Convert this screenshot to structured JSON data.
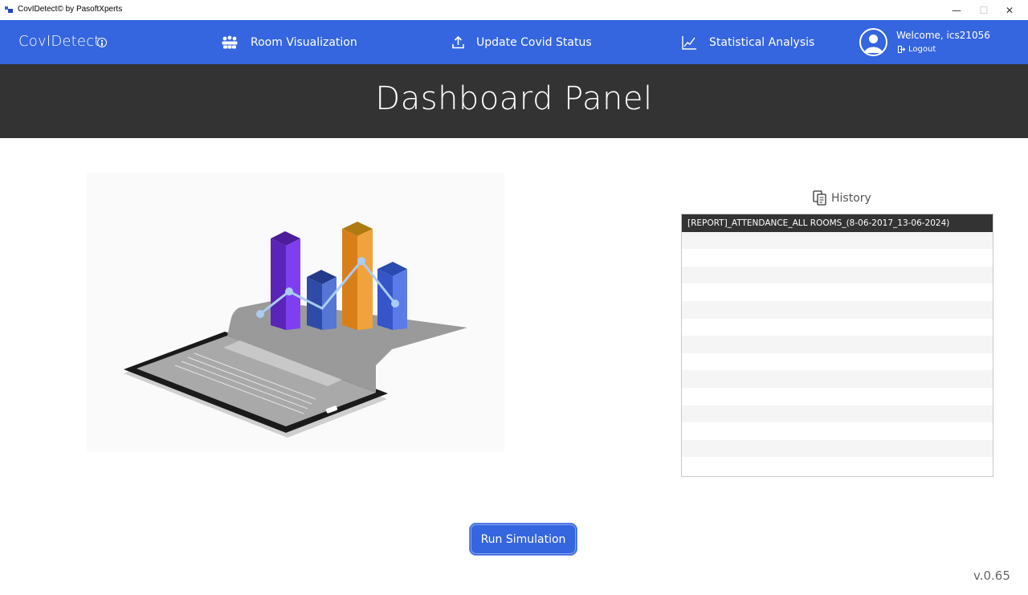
{
  "window": {
    "title": "CovIDetect© by PasoftXperts",
    "minimize_glyph": "—",
    "maximize_glyph": "☐",
    "close_glyph": "✕"
  },
  "nav": {
    "brand": "CovIDetect",
    "items": [
      {
        "label": "Room Visualization",
        "icon": "people-group-icon"
      },
      {
        "label": "Update Covid Status",
        "icon": "upload-icon"
      },
      {
        "label": "Statistical Analysis",
        "icon": "line-chart-icon"
      }
    ],
    "welcome": "Welcome, ics21056",
    "logout": "Logout"
  },
  "banner": {
    "title": "Dashboard Panel"
  },
  "history": {
    "title": "History",
    "items": [
      "[REPORT]_ATTENDANCE_ALL ROOMS_(8-06-2017_13-06-2024)"
    ]
  },
  "actions": {
    "run_simulation": "Run Simulation"
  },
  "footer": {
    "version": "v.0.65"
  },
  "colors": {
    "accent": "#3565df",
    "banner": "#333333"
  }
}
